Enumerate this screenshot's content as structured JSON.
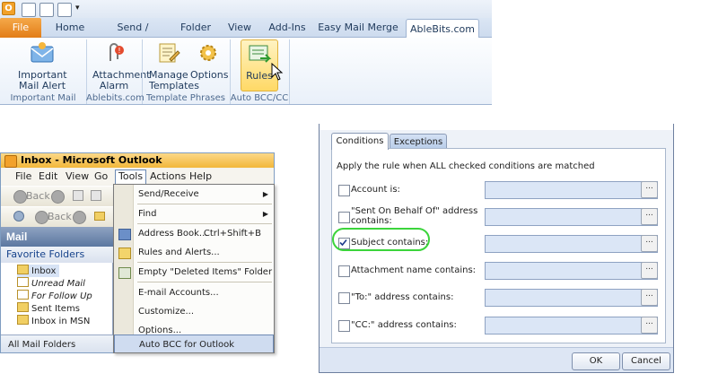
{
  "ribbon": {
    "tabs": [
      {
        "label": "File"
      },
      {
        "label": "Home"
      },
      {
        "label": "Send / Receive"
      },
      {
        "label": "Folder"
      },
      {
        "label": "View"
      },
      {
        "label": "Add-Ins"
      },
      {
        "label": "Easy Mail Merge"
      },
      {
        "label": "AbleBits.com"
      }
    ],
    "buttons": {
      "important_mail_alert": "Important Mail Alert",
      "attachment_alarm": "Attachment Alarm",
      "manage_templates": "Manage Templates",
      "options": "Options",
      "rules": "Rules"
    },
    "groups": {
      "important_mail_alert": "Important Mail Alert",
      "ablebits": "Ablebits.com",
      "template_phrases": "Template Phrases",
      "auto_bcc": "Auto BCC/CC"
    }
  },
  "outlook": {
    "title": "Inbox - Microsoft Outlook",
    "menu": [
      "File",
      "Edit",
      "View",
      "Go",
      "Tools",
      "Actions",
      "Help"
    ],
    "toolbar": {
      "back_1": "Back",
      "back_2": "Back"
    },
    "nav": {
      "pane_title": "Mail",
      "favorites_header": "Favorite Folders",
      "folders": [
        "Inbox",
        "Unread Mail",
        "For Follow Up",
        "Sent Items",
        "Inbox in MSN"
      ],
      "all_folders": "All Mail Folders"
    },
    "tools_menu": {
      "send_receive": "Send/Receive",
      "find": "Find",
      "address_book": "Address Book...",
      "address_book_shortcut": "Ctrl+Shift+B",
      "rules_alerts": "Rules and Alerts...",
      "empty_deleted": "Empty \"Deleted Items\" Folder",
      "email_accounts": "E-mail Accounts...",
      "customize": "Customize...",
      "options": "Options...",
      "auto_bcc": "Auto BCC for Outlook"
    }
  },
  "dialog": {
    "tabs": {
      "conditions": "Conditions",
      "exceptions": "Exceptions"
    },
    "header": "Apply the rule when ALL checked conditions are matched",
    "conditions": [
      {
        "label": "Account is:",
        "checked": false
      },
      {
        "label_line1": "\"Sent On Behalf Of\" address",
        "label_line2": "contains:",
        "checked": false
      },
      {
        "label": "Subject contains:",
        "checked": true
      },
      {
        "label": "Attachment name contains:",
        "checked": false
      },
      {
        "label": "\"To:\" address contains:",
        "checked": false
      },
      {
        "label": "\"CC:\" address contains:",
        "checked": false
      }
    ],
    "browse_label": "...",
    "ok": "OK",
    "cancel": "Cancel"
  },
  "colors": {
    "file_tab": "#e27d17",
    "highlight_circle": "#3bd43b",
    "input_fill": "#dbe6f6"
  }
}
